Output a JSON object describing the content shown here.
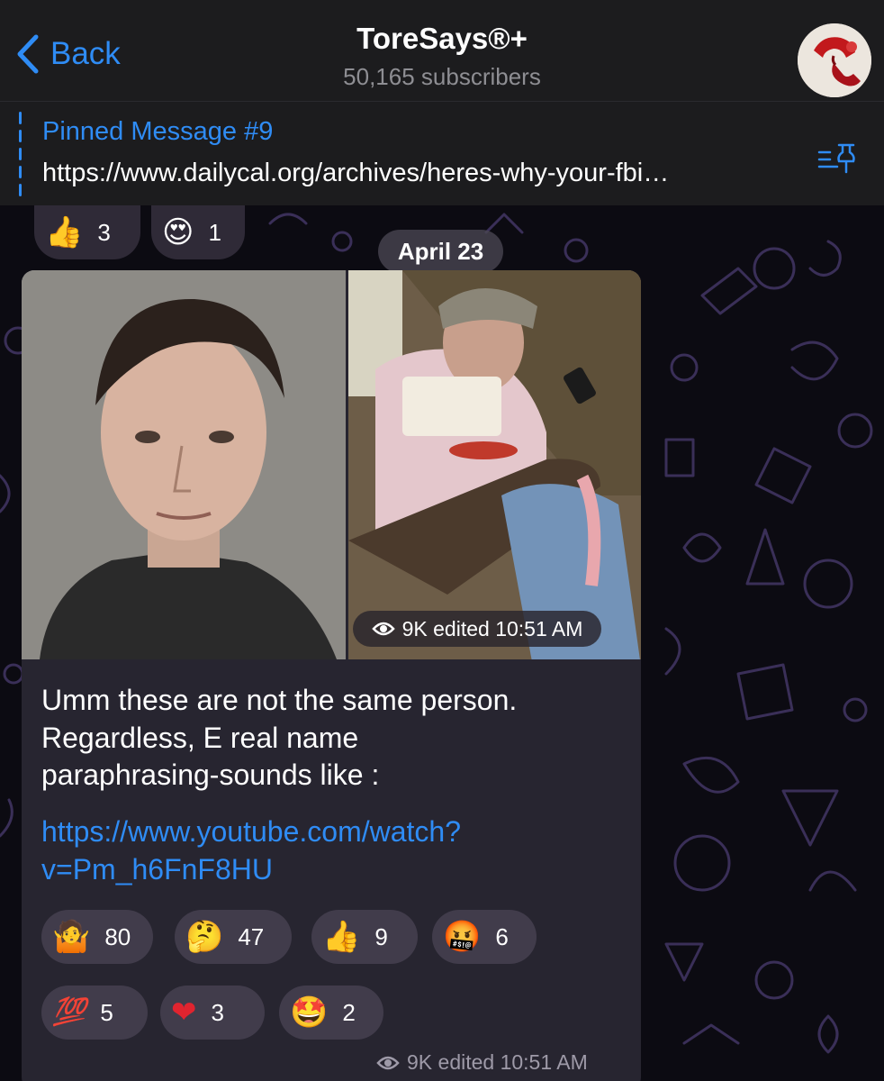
{
  "header": {
    "back_label": "Back",
    "title": "ToreSays®+",
    "subtitle": "50,165 subscribers"
  },
  "pinned": {
    "title": "Pinned Message #9",
    "text": "https://www.dailycal.org/archives/heres-why-your-fbi…"
  },
  "previous_reactions": [
    {
      "emoji": "👍",
      "count": "3"
    },
    {
      "emoji": "😍",
      "count": "1"
    }
  ],
  "date_chip": "April 23",
  "photo_meta": {
    "views": "9K",
    "label": "edited 10:51 AM"
  },
  "message": {
    "line1": "Umm these are not the same person.",
    "line2": "Regardless, E real name",
    "line3": "paraphrasing-sounds like :",
    "link_line1": "https://www.youtube.com/watch?",
    "link_line2": "v=Pm_h6FnF8HU"
  },
  "reactions": [
    {
      "emoji": "🤷",
      "count": "80"
    },
    {
      "emoji": "🤔",
      "count": "47"
    },
    {
      "emoji": "👍",
      "count": "9"
    },
    {
      "emoji": "🤬",
      "count": "6"
    },
    {
      "emoji": "💯",
      "count": "5"
    },
    {
      "emoji": "❤",
      "count": "3"
    },
    {
      "emoji": "🤩",
      "count": "2"
    }
  ],
  "footer_meta": {
    "views": "9K",
    "label": "edited 10:51 AM"
  },
  "colors": {
    "accent": "#2f8cf5",
    "header_bg": "#1c1c1e",
    "chat_bg": "#0c0b12",
    "bubble_bg": "#272530",
    "doodle": "#3a2f58"
  },
  "icons": [
    "chevron-left-icon",
    "pinned-list-icon",
    "eye-icon",
    "channel-avatar"
  ]
}
